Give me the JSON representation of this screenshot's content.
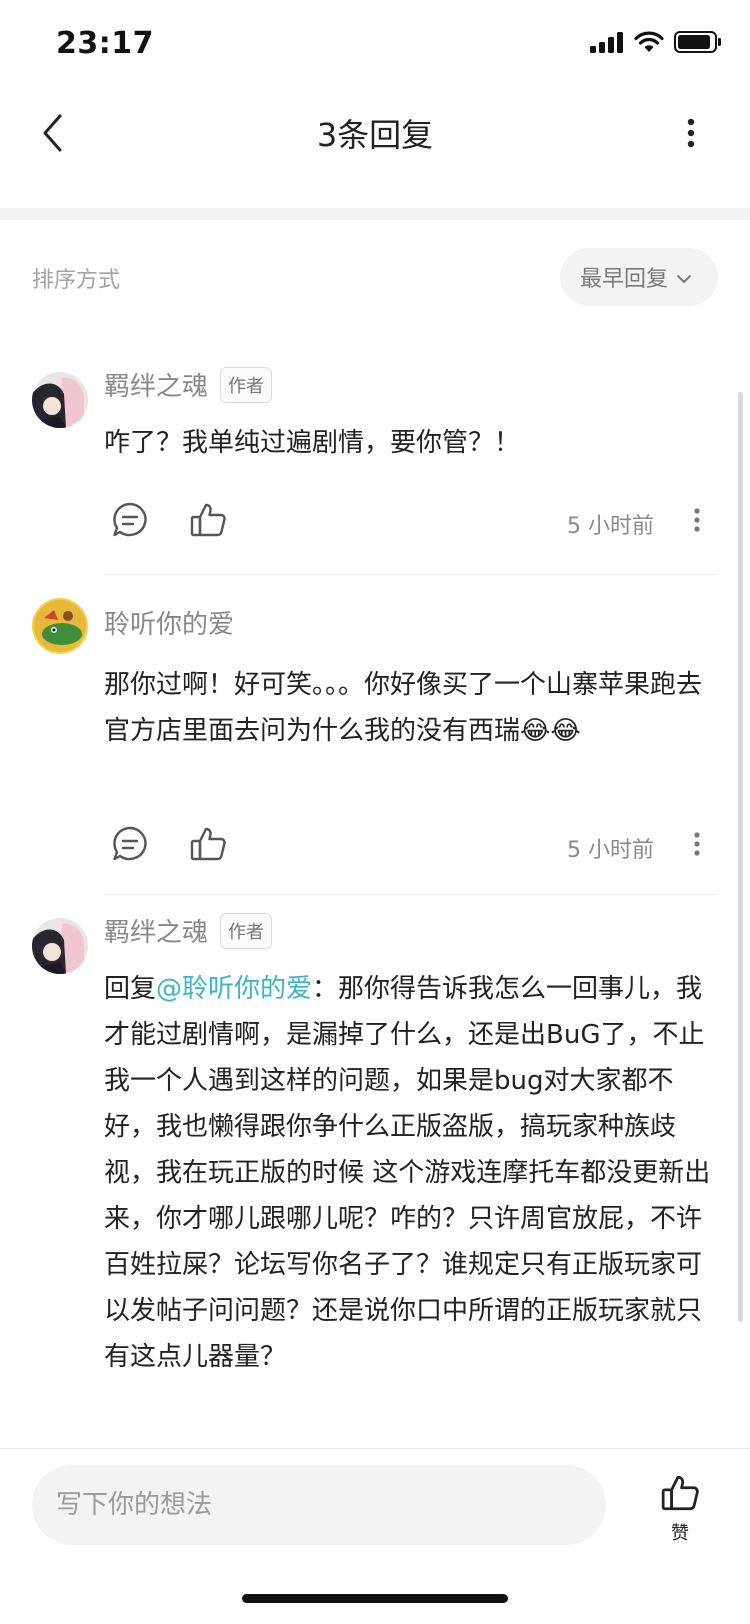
{
  "status_bar": {
    "time": "23:17"
  },
  "nav": {
    "title": "3条回复"
  },
  "sort": {
    "label": "排序方式",
    "selected": "最早回复"
  },
  "replies": [
    {
      "author": "羁绊之魂",
      "tag": "作者",
      "text": "咋了？我单纯过遍剧情，要你管？！",
      "time": "5 小时前"
    },
    {
      "author": "聆听你的爱",
      "tag": "",
      "text": "那你过啊！好可笑。。。你好像买了一个山寨苹果跑去官方店里面去问为什么我的没有西瑞😂😂",
      "time": "5 小时前"
    },
    {
      "author": "羁绊之魂",
      "tag": "作者",
      "reply_prefix": "回复",
      "mention": "@聆听你的爱",
      "text": "：那你得告诉我怎么一回事儿，我才能过剧情啊，是漏掉了什么，还是出BuG了，不止我一个人遇到这样的问题，如果是bug对大家都不好，我也懒得跟你争什么正版盗版，搞玩家种族歧视，我在玩正版的时候 这个游戏连摩托车都没更新出来，你才哪儿跟哪儿呢？咋的？只许周官放屁，不许百姓拉屎？论坛写你名子了？谁规定只有正版玩家可以发帖子问问题？还是说你口中所谓的正版玩家就只有这点儿器量？"
    }
  ],
  "bottom": {
    "placeholder": "写下你的想法",
    "like_label": "赞"
  },
  "colors": {
    "mention": "#3cb4c8",
    "muted": "#888888",
    "band": "#f2f3f5"
  }
}
